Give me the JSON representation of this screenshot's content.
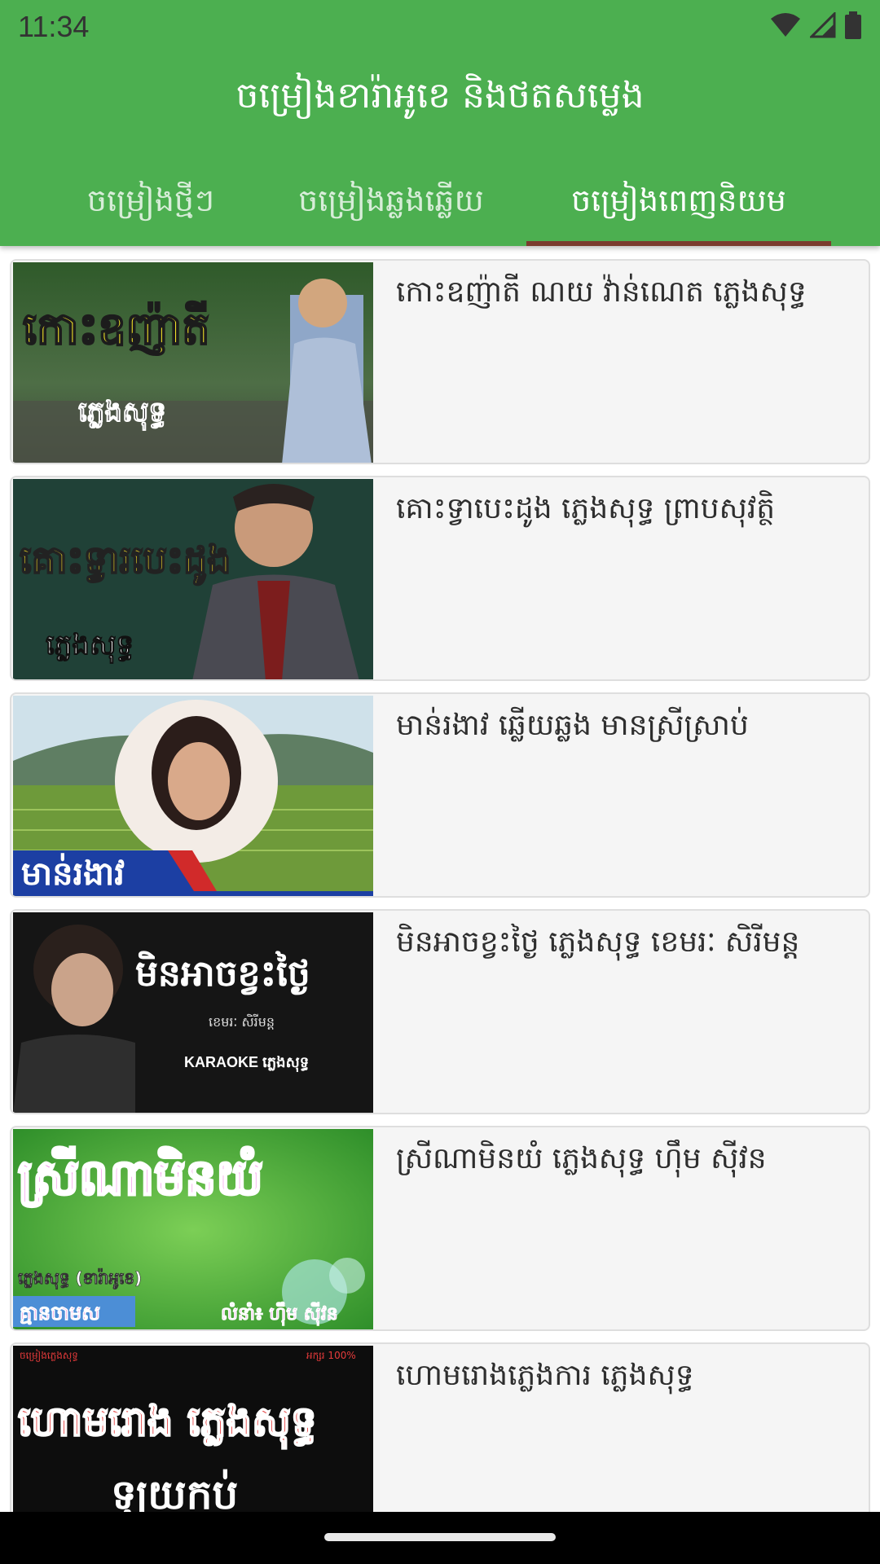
{
  "status": {
    "time": "11:34",
    "icons": [
      "wifi-icon",
      "signal-icon",
      "battery-icon"
    ]
  },
  "app": {
    "title": "ចម្រៀងខារ៉ាអូខេ និងថតសម្លេង",
    "accent": "#4CAF50",
    "indicator_color": "#7a3b2e"
  },
  "tabs": [
    {
      "label": "ចម្រៀងថ្មីៗ",
      "active": false
    },
    {
      "label": "ចម្រៀងឆ្លងឆ្លើយ",
      "active": false
    },
    {
      "label": "ចម្រៀងពេញនិយម",
      "active": true
    }
  ],
  "songs": [
    {
      "title": "កោះឧញ៉ាតី ណយ វ៉ាន់ណេត ភ្លេងសុទ្ធ",
      "thumb_text": [
        "កោះឧញ៉ាតី",
        "ភ្លេងសុទ្ធ"
      ]
    },
    {
      "title": "គោះទ្វាបេះដូង ភ្លេងសុទ្ធ ព្រាបសុវត្ថិ",
      "thumb_text": [
        "គោះទ្វារបេះដូង",
        "ភ្លេងសុទ្ធ"
      ]
    },
    {
      "title": "មាន់រងាវ ឆ្លើយឆ្លង មានស្រីស្រាប់",
      "thumb_text": [
        "មាន់រងាវ"
      ]
    },
    {
      "title": "មិនអាចខ្វះថ្ងៃ ភ្លេងសុទ្ធ ខេមរៈ សិរីមន្ត",
      "thumb_text": [
        "មិនអាចខ្វះថ្ងៃ",
        "ខេមរៈ សិរីមន្ត",
        "KARAOKE ភ្លេងសុទ្ធ"
      ]
    },
    {
      "title": "ស្រីណាមិនយំ ភ្លេងសុទ្ធ ហ៊ឹម ស៊ីវន",
      "thumb_text": [
        "ស្រីណាមិនយំ",
        "ភ្លេងសុទ្ធ (ខារ៉ាអូខេ)",
        "គ្មានចាមស",
        "លំនាំ៖ ហ៊ឹម ស៊ីវន"
      ]
    },
    {
      "title": "ហោមរោងភ្លេងការ ភ្លេងសុទ្ធ",
      "thumb_text": [
        "ហោមរោង ភ្លេងសុទ្ធ",
        "ឡូយកប់",
        "ចម្រៀងភ្លេងសុទ្ធ",
        "អក្សរ 100%"
      ]
    }
  ]
}
